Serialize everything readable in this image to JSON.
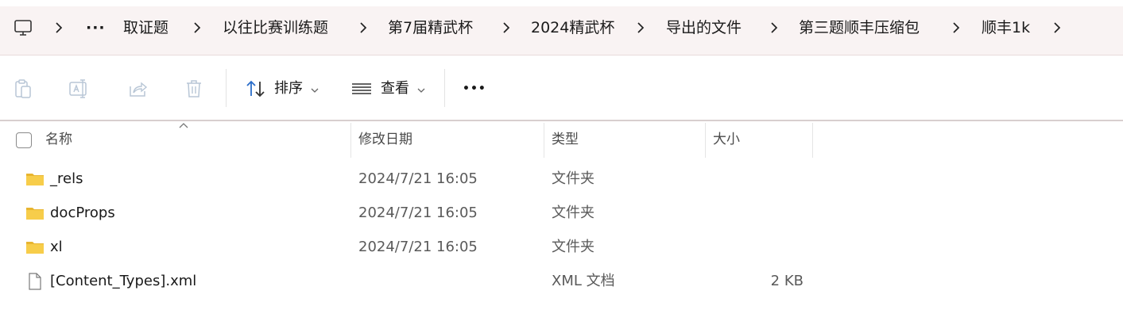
{
  "breadcrumb": {
    "items": [
      "取证题",
      "以往比赛训练题",
      "第7届精武杯",
      "2024精武杯",
      "导出的文件",
      "第三题顺丰压缩包",
      "顺丰1k"
    ],
    "overflow": "···"
  },
  "toolbar": {
    "sort_label": "排序",
    "view_label": "查看",
    "more_label": "•••"
  },
  "columns": {
    "name": "名称",
    "date": "修改日期",
    "type": "类型",
    "size": "大小"
  },
  "files": [
    {
      "name": "_rels",
      "date": "2024/7/21 16:05",
      "type": "文件夹",
      "size": "",
      "icon": "folder-icon"
    },
    {
      "name": "docProps",
      "date": "2024/7/21 16:05",
      "type": "文件夹",
      "size": "",
      "icon": "folder-icon"
    },
    {
      "name": "xl",
      "date": "2024/7/21 16:05",
      "type": "文件夹",
      "size": "",
      "icon": "folder-icon"
    },
    {
      "name": "[Content_Types].xml",
      "date": "",
      "type": "XML 文档",
      "size": "2 KB",
      "icon": "document-icon"
    }
  ],
  "colors": {
    "folder": "#f5c542",
    "accent": "#2a6dc9",
    "crumbbar_bg": "#f9f3f3"
  }
}
